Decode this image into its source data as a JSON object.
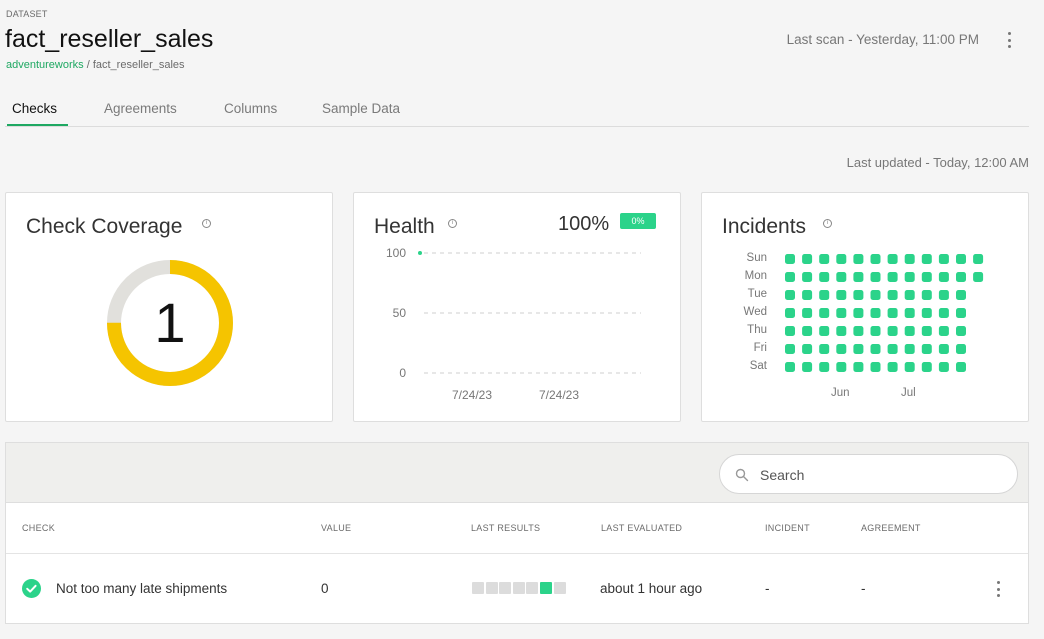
{
  "header": {
    "kicker": "DATASET",
    "title": "fact_reseller_sales",
    "breadcrumb_link": "adventureworks",
    "breadcrumb_sep": " / ",
    "breadcrumb_current": "fact_reseller_sales",
    "last_scan": "Last scan - Yesterday, 11:00 PM"
  },
  "tabs": [
    {
      "label": "Checks",
      "active": true
    },
    {
      "label": "Agreements",
      "active": false
    },
    {
      "label": "Columns",
      "active": false
    },
    {
      "label": "Sample Data",
      "active": false
    }
  ],
  "last_updated": "Last updated - Today, 12:00 AM",
  "coverage": {
    "title": "Check Coverage",
    "value": "1",
    "covered_fraction": 0.75
  },
  "health": {
    "title": "Health",
    "percent": "100%",
    "delta": "0%"
  },
  "incidents": {
    "title": "Incidents",
    "days": [
      "Sun",
      "Mon",
      "Tue",
      "Wed",
      "Thu",
      "Fri",
      "Sat"
    ],
    "weeks_per_day": [
      12,
      12,
      11,
      11,
      11,
      11,
      11
    ],
    "months": [
      "Jun",
      "Jul"
    ],
    "dot_color": "#2bd38a"
  },
  "chart_data": {
    "type": "line",
    "title": "Health",
    "x": [
      "7/24/23"
    ],
    "x_tick_labels": [
      "7/24/23",
      "7/24/23"
    ],
    "y_ticks": [
      "100",
      "50",
      "0"
    ],
    "series": [
      {
        "values": [
          100
        ]
      }
    ],
    "ylim": [
      0,
      100
    ],
    "grid": true,
    "line_color": "#2bd38a"
  },
  "table": {
    "search_placeholder": "Search",
    "columns": [
      "CHECK",
      "VALUE",
      "LAST RESULTS",
      "LAST EVALUATED",
      "INCIDENT",
      "AGREEMENT"
    ],
    "rows": [
      {
        "check": "Not too many late shipments",
        "value": "0",
        "last_results": [
          "none",
          "none",
          "none",
          "none",
          "none",
          "pass",
          "none"
        ],
        "last_evaluated": "about 1 hour ago",
        "incident": "-",
        "agreement": "-"
      }
    ]
  },
  "colors": {
    "accent": "#1ea862",
    "pass": "#2bd38a",
    "coverage": "#f5c400",
    "ring_track": "#e1e0dc"
  }
}
